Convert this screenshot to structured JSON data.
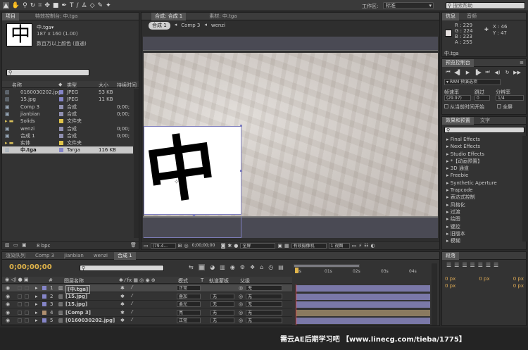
{
  "toolbar": {
    "workspace_label": "工作区:",
    "workspace_value": "标准",
    "search_placeholder": "搜索帮助"
  },
  "project": {
    "tabs": [
      "项目",
      "特效控制台: 中.tga"
    ],
    "preview": {
      "name": "中.tga▾",
      "dims": "187 x 160 (1.00)",
      "desc": "数百万以上颜色 (直通)"
    },
    "columns": {
      "name": "名称",
      "type": "类型",
      "size": "大小",
      "duration": "持续时间"
    },
    "items": [
      {
        "icon": "img",
        "name": "0160030202.jpg",
        "color": "#8585c8",
        "type": "JPEG",
        "size": "53 KB",
        "dur": ""
      },
      {
        "icon": "img",
        "name": "15.jpg",
        "color": "#8585c8",
        "type": "JPEG",
        "size": "11 KB",
        "dur": ""
      },
      {
        "icon": "comp",
        "name": "Comp 3",
        "color": "#8f8fb0",
        "type": "合成",
        "size": "",
        "dur": "0;00;"
      },
      {
        "icon": "comp",
        "name": "jianbian",
        "color": "#8f8fb0",
        "type": "合成",
        "size": "",
        "dur": "0;00;"
      },
      {
        "icon": "folder",
        "name": "Solids",
        "color": "#e0c44a",
        "type": "文件夹",
        "size": "",
        "dur": ""
      },
      {
        "icon": "comp",
        "name": "wenzi",
        "color": "#8f8fb0",
        "type": "合成",
        "size": "",
        "dur": "0;00;"
      },
      {
        "icon": "comp",
        "name": "合成 1",
        "color": "#8f8fb0",
        "type": "合成",
        "size": "",
        "dur": "0;00;"
      },
      {
        "icon": "folder",
        "name": "实体",
        "color": "#e0c44a",
        "type": "文件夹",
        "size": "",
        "dur": ""
      },
      {
        "icon": "img",
        "name": "中.tga",
        "color": "#8585c8",
        "type": "Targa",
        "size": "116 KB",
        "dur": "",
        "selected": true
      }
    ],
    "bpc": "8 bpc"
  },
  "composition": {
    "tabs": [
      "合成: 合成 1",
      "素材: 中.tga"
    ],
    "breadcrumbs": [
      "合成 1",
      "Comp 3",
      "wenzi"
    ],
    "bottom": {
      "zoom": "(79.4...",
      "timecode": "0;00;00;00",
      "quality": "全屏",
      "camera": "有效摄像机",
      "views": "1 视图"
    },
    "glyph": "中"
  },
  "info": {
    "tabs": [
      "信息",
      "音频"
    ],
    "R": "R : 229",
    "G": "G : 224",
    "B": "B : 223",
    "A": "A : 255",
    "X": "X : 46",
    "Y": "Y : 47",
    "file": "中.tga",
    "swatch": "#e5e0df"
  },
  "preview_panel": {
    "title": "预览控制台",
    "ram": "RAM 预演选项",
    "fps_label": "帧速率",
    "skip_label": "跳过",
    "res_label": "分辨率",
    "fps": "(29.97)",
    "skip": "0",
    "res": "1/4",
    "from_current": "从当前时间开始",
    "full": "全屏"
  },
  "effects": {
    "tabs": [
      "效果和预置",
      "文字"
    ],
    "items": [
      "Final Effects",
      "Next Effects",
      "Studio Effects",
      "*【动画预置】",
      "3D 通道",
      "Freebie",
      "Synthetic Aperture",
      "Trapcode",
      "表达式控制",
      "风格化",
      "过渡",
      "绘图",
      "键控",
      "旧版本",
      "模糊"
    ]
  },
  "paragraph": {
    "tab": "段落",
    "px": "0 px"
  },
  "timeline": {
    "tabs": [
      "渲染队列",
      "Comp 3",
      "jianbian",
      "wenzi",
      "合成 1"
    ],
    "timecode": "0;00;00;00",
    "header": {
      "num": "#",
      "name": "图层名称",
      "mode": "模式",
      "t": "T",
      "trkmat": "轨道蒙板",
      "parent": "父级"
    },
    "rulers": [
      "0s",
      "01s",
      "02s",
      "03s",
      "04s"
    ],
    "layers": [
      {
        "n": "1",
        "name": "[中.tga]",
        "color": "#8585c8",
        "mode": "正常",
        "trk": "",
        "parent": "无",
        "selected": true
      },
      {
        "n": "2",
        "name": "[15.jpg]",
        "color": "#8585c8",
        "mode": "叠加",
        "trk": "无",
        "parent": "无"
      },
      {
        "n": "3",
        "name": "[15.jpg]",
        "color": "#8585c8",
        "mode": "柔光",
        "trk": "无",
        "parent": "无"
      },
      {
        "n": "4",
        "name": "[Comp 3]",
        "color": "#b09070",
        "mode": "亮",
        "trk": "无",
        "parent": "无"
      },
      {
        "n": "5",
        "name": "[0160030202.jpg]",
        "color": "#8585c8",
        "mode": "正常",
        "trk": "无",
        "parent": "无"
      }
    ]
  },
  "watermark": "需云AE后期学习吧 【www.linecg.com/tieba/1775】"
}
